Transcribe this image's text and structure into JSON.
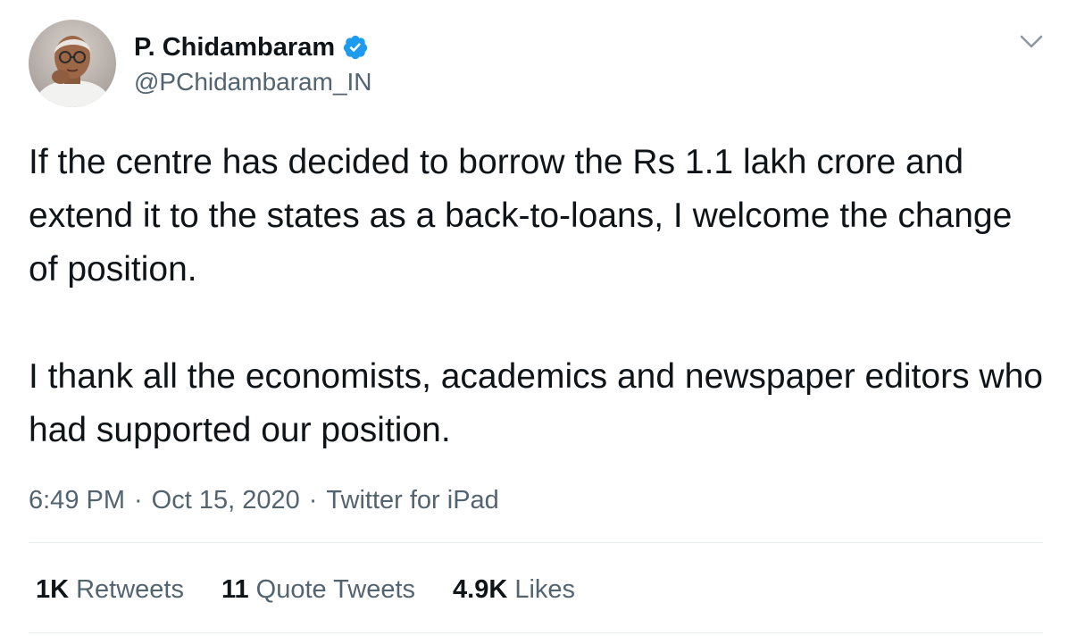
{
  "author": {
    "display_name": "P. Chidambaram",
    "handle": "@PChidambaram_IN",
    "verified": true,
    "verified_color": "#1d9bf0"
  },
  "tweet": {
    "paragraphs": [
      "If the centre has decided to borrow the Rs 1.1 lakh crore and extend it to the states as a back-to-loans, I welcome the change of position.",
      "I thank all the economists, academics  and newspaper editors who had supported our position."
    ]
  },
  "meta": {
    "time": "6:49 PM",
    "separator": "·",
    "date": "Oct 15, 2020",
    "source": "Twitter for iPad"
  },
  "stats": {
    "retweets": {
      "count": "1K",
      "label": "Retweets"
    },
    "quotes": {
      "count": "11",
      "label": "Quote Tweets"
    },
    "likes": {
      "count": "4.9K",
      "label": "Likes"
    }
  },
  "icons": {
    "verified": "verified-badge-icon",
    "menu": "chevron-down-icon"
  },
  "colors": {
    "text_primary": "#0f1419",
    "text_secondary": "#536471",
    "divider": "#e6ecf0"
  }
}
